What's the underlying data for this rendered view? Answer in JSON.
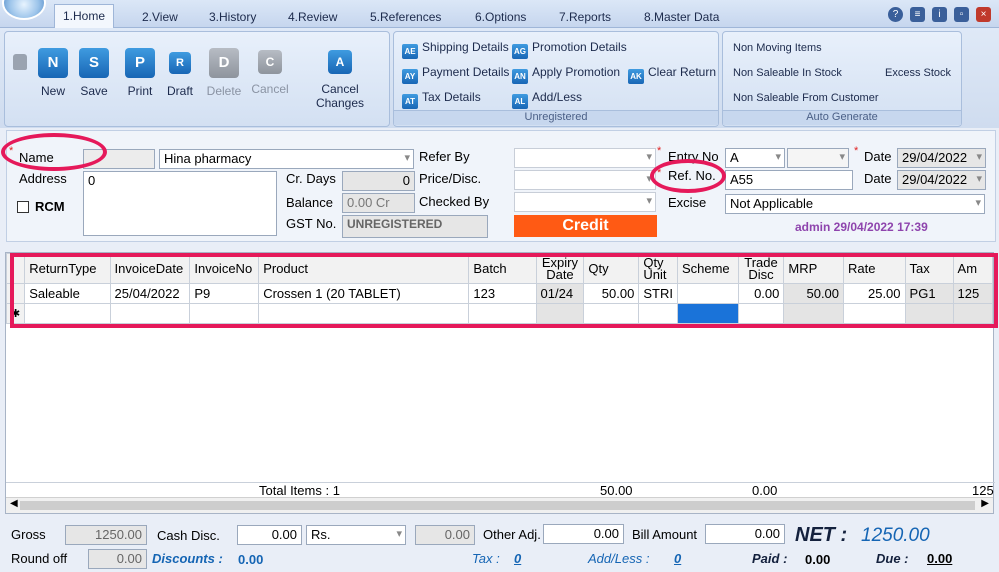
{
  "tabs": [
    "1.Home",
    "2.View",
    "3.History",
    "4.Review",
    "5.References",
    "6.Options",
    "7.Reports",
    "8.Master Data"
  ],
  "toolbar": {
    "new": "New",
    "save": "Save",
    "print": "Print",
    "draft": "Draft",
    "delete": "Delete",
    "cancel": "Cancel",
    "cancel_changes": "Cancel Changes",
    "icon_new": "N",
    "icon_save": "S",
    "icon_print": "P",
    "icon_draft": "R",
    "icon_delete": "D",
    "icon_cancel": "C",
    "icon_cancel_changes": "A"
  },
  "unregistered": {
    "label": "Unregistered",
    "shipping": "Shipping Details",
    "payment": "Payment Details",
    "tax": "Tax Details",
    "promotion": "Promotion Details",
    "apply_promotion": "Apply Promotion",
    "add_less": "Add/Less",
    "clear_return": "Clear Return"
  },
  "auto_generate": {
    "label": "Auto Generate",
    "non_moving": "Non Moving Items",
    "non_saleable_stock": "Non Saleable In Stock",
    "non_saleable_customer": "Non Saleable From Customer",
    "excess_stock": "Excess Stock"
  },
  "form": {
    "name_label": "Name",
    "name_value": "Hina pharmacy",
    "address_label": "Address",
    "address_value": "0",
    "rcm_label": "RCM",
    "cr_days_label": "Cr. Days",
    "cr_days_value": "0",
    "balance_label": "Balance",
    "balance_value": "0.00 Cr",
    "gst_label": "GST No.",
    "gst_value": "UNREGISTERED",
    "refer_by_label": "Refer By",
    "price_disc_label": "Price/Disc.",
    "checked_by_label": "Checked By",
    "credit": "Credit",
    "entry_no_label": "Entry No.",
    "entry_no_value": "A",
    "ref_no_label": "Ref. No.",
    "ref_no_value": "A55",
    "excise_label": "Excise",
    "excise_value": "Not Applicable",
    "date_label": "Date",
    "date1": "29/04/2022",
    "date2": "29/04/2022",
    "user_stamp": "admin 29/04/2022 17:39"
  },
  "grid": {
    "headers": [
      "ReturnType",
      "InvoiceDate",
      "InvoiceNo",
      "Product",
      "Batch",
      "Expiry Date",
      "Qty",
      "Qty Unit",
      "Scheme",
      "Trade Disc",
      "MRP",
      "Rate",
      "Tax",
      "Am"
    ],
    "row": [
      "Saleable",
      "25/04/2022",
      "P9",
      "Crossen 1 (20 TABLET)",
      "123",
      "01/24",
      "50.00",
      "STRI",
      "",
      "0.00",
      "50.00",
      "25.00",
      "PG1",
      "125"
    ],
    "total_items": "Total Items : 1",
    "total_qty": "50.00",
    "total_trade": "0.00",
    "total_amt": "125"
  },
  "footer": {
    "gross_label": "Gross",
    "gross_value": "1250.00",
    "cash_disc_label": "Cash Disc.",
    "cash_disc_value": "0.00",
    "cash_disc_unit": "Rs.",
    "cash_disc_amt": "0.00",
    "other_adj_label": "Other Adj.",
    "other_adj_value": "0.00",
    "bill_amount_label": "Bill Amount",
    "bill_amount_value": "0.00",
    "net_label": "NET :",
    "net_value": "1250.00",
    "round_off_label": "Round off",
    "round_off_value": "0.00",
    "discounts_label": "Discounts :",
    "discounts_value": "0.00",
    "tax_label": "Tax :",
    "tax_value": "0",
    "addless_label": "Add/Less :",
    "addless_value": "0",
    "paid_label": "Paid :",
    "paid_value": "0.00",
    "due_label": "Due :",
    "due_value": "0.00"
  },
  "accent_colors": {
    "highlight": "#e5195a",
    "credit": "#ff5a14",
    "link": "#1565b4"
  }
}
